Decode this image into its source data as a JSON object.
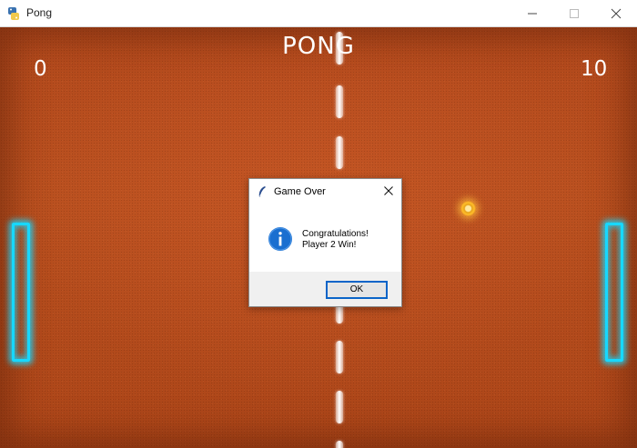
{
  "window": {
    "title": "Pong",
    "app_icon": "python-icon",
    "controls": [
      "minimize-icon",
      "maximize-icon",
      "close-icon"
    ]
  },
  "game": {
    "title": "PONG",
    "score_player1": "0",
    "score_player2": "10",
    "colors": {
      "court": "#b44a1d",
      "paddle": "#17d8ff",
      "ball": "#ffbf2a",
      "text": "#ffffff"
    }
  },
  "dialog": {
    "title": "Game Over",
    "icon": "feather-icon",
    "info_icon": "info-icon",
    "message_line1": "Congratulations!",
    "message_line2": "Player 2 Win!",
    "ok_label": "OK",
    "accent": "#0a64c8"
  }
}
